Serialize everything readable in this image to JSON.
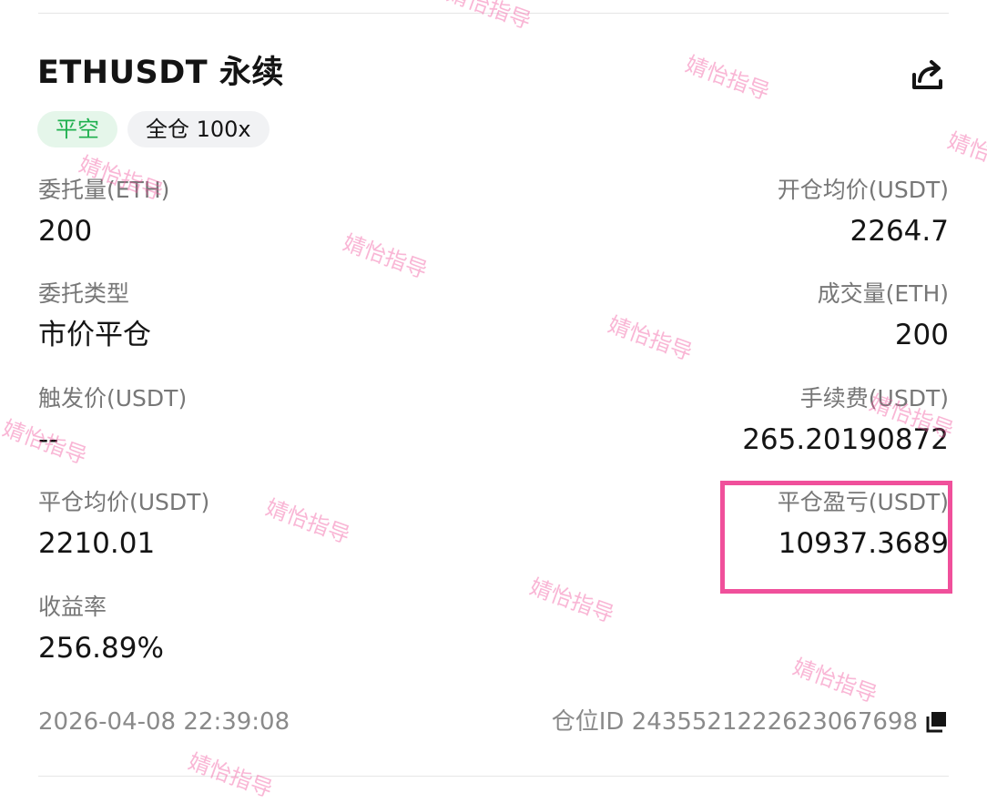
{
  "order": {
    "title": "ETHUSDT 永续",
    "tags": {
      "side": "平空",
      "margin": "全仓 100x"
    },
    "fields": {
      "order_qty": {
        "label": "委托量(ETH)",
        "value": "200"
      },
      "avg_open_price": {
        "label": "开仓均价(USDT)",
        "value": "2264.7"
      },
      "order_type": {
        "label": "委托类型",
        "value": "市价平仓"
      },
      "filled_qty": {
        "label": "成交量(ETH)",
        "value": "200"
      },
      "trigger_price": {
        "label": "触发价(USDT)",
        "value": "--"
      },
      "fee": {
        "label": "手续费(USDT)",
        "value": "265.20190872"
      },
      "avg_close_price": {
        "label": "平仓均价(USDT)",
        "value": "2210.01"
      },
      "close_pnl": {
        "label": "平仓盈亏(USDT)",
        "value": "10937.3689"
      },
      "roi": {
        "label": "收益率",
        "value": "256.89%"
      }
    },
    "footer": {
      "time": "2026-04-08 22:39:08",
      "position_id": "仓位ID 2435521222623067698"
    }
  },
  "watermark": "婧怡指导",
  "colors": {
    "accent_green": "#20b04f",
    "highlight_pink": "#f0509b"
  },
  "icons": {
    "share": "share-icon",
    "copy": "copy-icon"
  }
}
